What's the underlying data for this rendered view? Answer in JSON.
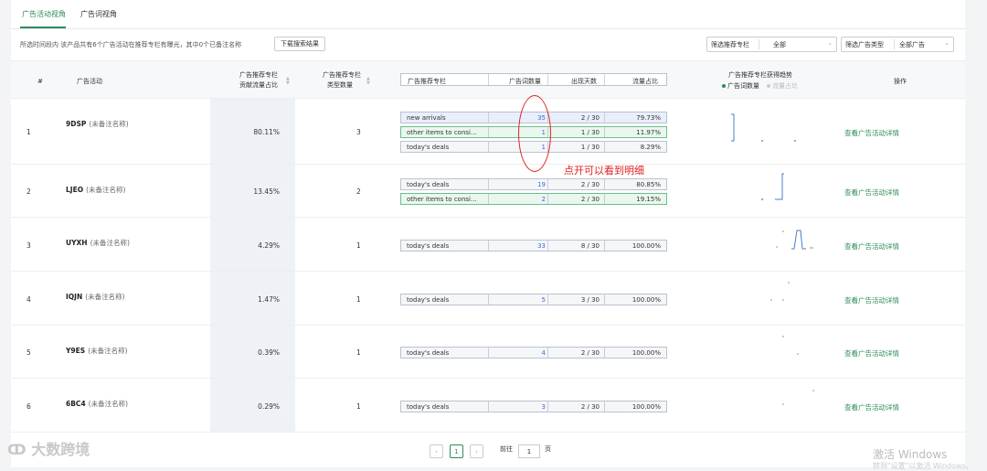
{
  "tabs": [
    {
      "label": "广告活动视角"
    },
    {
      "label": "广告词视角"
    }
  ],
  "info_text": "所选时间段内 该产品共有6个广告活动在推荐专栏有曝光，其中0个已备注名称",
  "download_label": "下载搜索结果",
  "filters": [
    {
      "label": "筛选推荐专栏",
      "value": "全部"
    },
    {
      "label": "筛选广告类型",
      "value": "全部广告"
    }
  ],
  "columns": {
    "index": "#",
    "campaign": "广告活动",
    "share_line1": "广告推荐专栏",
    "share_line2": "贡献流量占比",
    "types_line1": "广告推荐专栏",
    "types_line2": "类型数量",
    "sub_col_name": "广告推荐专栏",
    "sub_col_count": "广告词数量",
    "sub_col_days": "出现天数",
    "sub_col_pct": "流量占比",
    "trend_title": "广告推荐专栏获得趋势",
    "trend_legend_active": "广告词数量",
    "trend_legend_inactive": "流量占比",
    "action": "操作"
  },
  "rows": [
    {
      "index": "1",
      "name": "9DSP",
      "note": "(未备注名称)",
      "share": "80.11%",
      "types": "3",
      "link": "查看广告活动详情",
      "subs": [
        {
          "name": "new arrivals",
          "count": "35",
          "days": "2 / 30",
          "pct": "79.73%",
          "color": "blue"
        },
        {
          "name": "other items to consi...",
          "count": "1",
          "days": "1 / 30",
          "pct": "11.97%",
          "color": "green"
        },
        {
          "name": "today's deals",
          "count": "1",
          "days": "1 / 30",
          "pct": "8.29%",
          "color": "gray"
        }
      ]
    },
    {
      "index": "2",
      "name": "LJEO",
      "note": "(未备注名称)",
      "share": "13.45%",
      "types": "2",
      "link": "查看广告活动详情",
      "subs": [
        {
          "name": "today's deals",
          "count": "19",
          "days": "2 / 30",
          "pct": "80.85%",
          "color": "gray"
        },
        {
          "name": "other items to consi...",
          "count": "2",
          "days": "2 / 30",
          "pct": "19.15%",
          "color": "green"
        }
      ]
    },
    {
      "index": "3",
      "name": "UYXH",
      "note": "(未备注名称)",
      "share": "4.29%",
      "types": "1",
      "link": "查看广告活动详情",
      "subs": [
        {
          "name": "today's deals",
          "count": "33",
          "days": "8 / 30",
          "pct": "100.00%",
          "color": "gray"
        }
      ]
    },
    {
      "index": "4",
      "name": "IQJN",
      "note": "(未备注名称)",
      "share": "1.47%",
      "types": "1",
      "link": "查看广告活动详情",
      "subs": [
        {
          "name": "today's deals",
          "count": "5",
          "days": "3 / 30",
          "pct": "100.00%",
          "color": "gray"
        }
      ]
    },
    {
      "index": "5",
      "name": "Y9ES",
      "note": "(未备注名称)",
      "share": "0.39%",
      "types": "1",
      "link": "查看广告活动详情",
      "subs": [
        {
          "name": "today's deals",
          "count": "4",
          "days": "2 / 30",
          "pct": "100.00%",
          "color": "gray"
        }
      ]
    },
    {
      "index": "6",
      "name": "6BC4",
      "note": "(未备注名称)",
      "share": "0.29%",
      "types": "1",
      "link": "查看广告活动详情",
      "subs": [
        {
          "name": "today's deals",
          "count": "3",
          "days": "2 / 30",
          "pct": "100.00%",
          "color": "gray"
        }
      ]
    }
  ],
  "annotation": "点开可以看到明细",
  "pagination": {
    "current": "1",
    "goto_prefix": "前往",
    "goto_value": "1",
    "goto_suffix": "页"
  },
  "watermark": "大数跨境",
  "windows_text": "激活 Windows",
  "windows_sub": "转到\"设置\"以激活 Windows。",
  "colors": {
    "accent": "#2e8b57",
    "link_blue": "#3b6fd8",
    "annotation_red": "#e02020"
  }
}
